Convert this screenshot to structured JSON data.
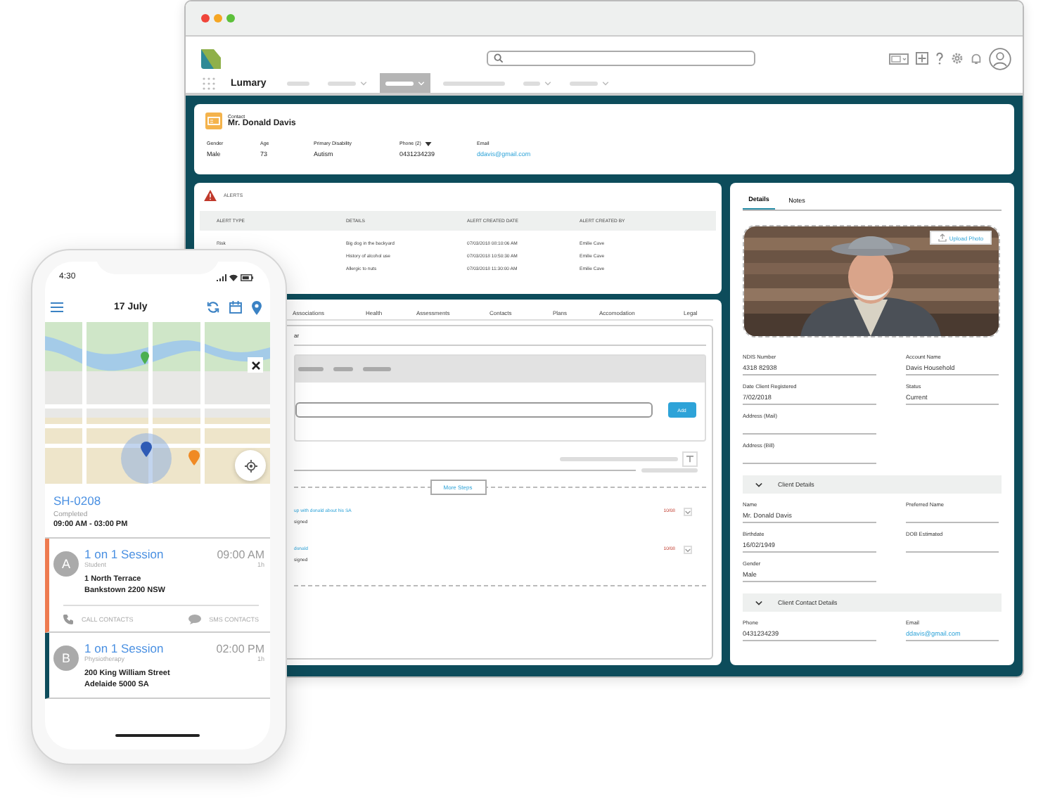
{
  "browser": {
    "app_name": "Lumary",
    "nav_items": [
      {
        "selected": false,
        "dropdown": false
      },
      {
        "selected": false,
        "dropdown": true
      },
      {
        "selected": true,
        "dropdown": true
      },
      {
        "selected": false,
        "dropdown": false
      },
      {
        "selected": false,
        "dropdown": true
      },
      {
        "selected": false,
        "dropdown": true
      }
    ]
  },
  "contact_header": {
    "type_label": "Contact",
    "name": "Mr. Donald Davis",
    "fields": [
      {
        "label": "Gender",
        "value": "Male",
        "kind": "text"
      },
      {
        "label": "Age",
        "value": "73",
        "kind": "text"
      },
      {
        "label": "Primary Disability",
        "value": "Autism",
        "kind": "text"
      },
      {
        "label": "Phone (2)",
        "value": "0431234239",
        "kind": "dropdown"
      },
      {
        "label": "Email",
        "value": "ddavis@gmail.com",
        "kind": "link"
      }
    ]
  },
  "alerts": {
    "title": "ALERTS",
    "columns": [
      "ALERT TYPE",
      "DETAILS",
      "ALERT CREATED DATE",
      "ALERT CREATED BY"
    ],
    "rows": [
      {
        "type": "Risk",
        "details": "Big dog in the backyard",
        "created_date": "07/03/2018 08:10:06 AM",
        "created_by": "Emilie Cave"
      },
      {
        "details": "History of alcohol use",
        "created_date": "07/03/2018 10:50:30 AM",
        "created_by": "Emilie Cave"
      },
      {
        "details": "Allergic to nuts",
        "created_date": "07/03/2018 11:30:00 AM",
        "created_by": "Emilie Cave"
      }
    ]
  },
  "record_tabs": {
    "tabs": [
      {
        "label": "Associations",
        "selected": false
      },
      {
        "label": "Health",
        "selected": false
      },
      {
        "label": "Assessments",
        "selected": false
      },
      {
        "label": "Contacts",
        "selected": false
      },
      {
        "label": "Plans",
        "selected": false
      },
      {
        "label": "Accomodation",
        "selected": false
      },
      {
        "label": "Legal",
        "selected": false
      }
    ],
    "heading": "ar",
    "add_button": "Add",
    "more_button": "More Steps",
    "tasks": [
      {
        "title": "up with donald about his SA",
        "status": "signed",
        "date": "10/08"
      },
      {
        "title": "donald",
        "status": "signed",
        "date": "10/08"
      }
    ]
  },
  "details_panel": {
    "tabs": [
      {
        "label": "Details",
        "selected": true
      },
      {
        "label": "Notes",
        "selected": false
      }
    ],
    "photo": {
      "kind": "picture",
      "upload_button": "Upload Photo"
    },
    "rows": [
      [
        {
          "label": "NDIS Number",
          "value": "4318 82938"
        },
        {
          "label": "Account Name",
          "value": "Davis Household"
        }
      ],
      [
        {
          "label": "Date Client Registered",
          "value": "7/02/2018"
        },
        {
          "label": "Status",
          "value": "Current"
        }
      ],
      [
        {
          "label": "Address (Mail)"
        }
      ],
      [
        {
          "label": "Address (Bill)"
        }
      ]
    ],
    "sections": [
      {
        "title": "Client Details",
        "expanded": true,
        "rows": [
          [
            {
              "label": "Name",
              "value": "Mr. Donald Davis"
            },
            {
              "label": "Preferred Name"
            }
          ],
          [
            {
              "label": "Birthdate",
              "value": "16/02/1949"
            },
            {
              "label": "DOB Estimated"
            }
          ],
          [
            {
              "label": "Gender",
              "value": "Male"
            }
          ]
        ]
      },
      {
        "title": "Client Contact Details",
        "expanded": true,
        "rows": [
          [
            {
              "label": "Phone",
              "value": "0431234239"
            },
            {
              "label": "Email",
              "value": "ddavis@gmail.com",
              "kind": "link"
            }
          ]
        ]
      }
    ]
  },
  "phone": {
    "status_bar": {
      "time": "4:30"
    },
    "header": {
      "date": "17 July"
    },
    "shift": {
      "id": "SH-0208",
      "status": "Completed",
      "time_range": "09:00 AM - 03:00 PM"
    },
    "appointments": [
      {
        "badge": "A",
        "title": "1 on 1 Session",
        "time": "09:00 AM",
        "category": "Student",
        "duration": "1h",
        "address_lines": [
          "1 North Terrace",
          "Bankstown 2200 NSW"
        ],
        "color": "#ee7b50",
        "actions": [
          {
            "kind": "call",
            "label": "CALL CONTACTS"
          },
          {
            "kind": "sms",
            "label": "SMS CONTACTS"
          }
        ]
      },
      {
        "badge": "B",
        "title": "1 on 1 Session",
        "time": "02:00 PM",
        "category": "Physiotherapy",
        "duration": "1h",
        "address_lines": [
          "200 King William Street",
          "Adelaide 5000 SA"
        ],
        "color": "#0d4c5b"
      }
    ]
  }
}
